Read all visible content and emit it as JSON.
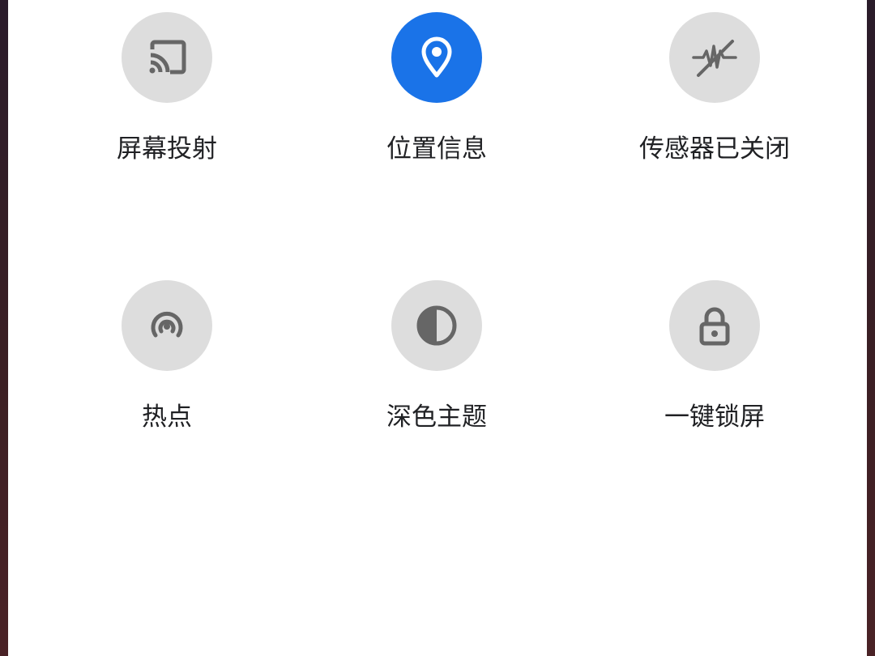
{
  "colors": {
    "tile_inactive": "#dddddd",
    "tile_active": "#1a73e8",
    "icon_inactive": "#666666",
    "icon_active": "#ffffff",
    "label": "#202124"
  },
  "tiles": [
    {
      "label": "屏幕投射",
      "icon": "cast-icon",
      "active": false
    },
    {
      "label": "位置信息",
      "icon": "location-pin-icon",
      "active": true
    },
    {
      "label": "传感器已关闭",
      "icon": "sensors-off-icon",
      "active": false
    },
    {
      "label": "热点",
      "icon": "hotspot-icon",
      "active": false
    },
    {
      "label": "深色主题",
      "icon": "dark-theme-icon",
      "active": false
    },
    {
      "label": "一键锁屏",
      "icon": "lock-icon",
      "active": false
    }
  ]
}
